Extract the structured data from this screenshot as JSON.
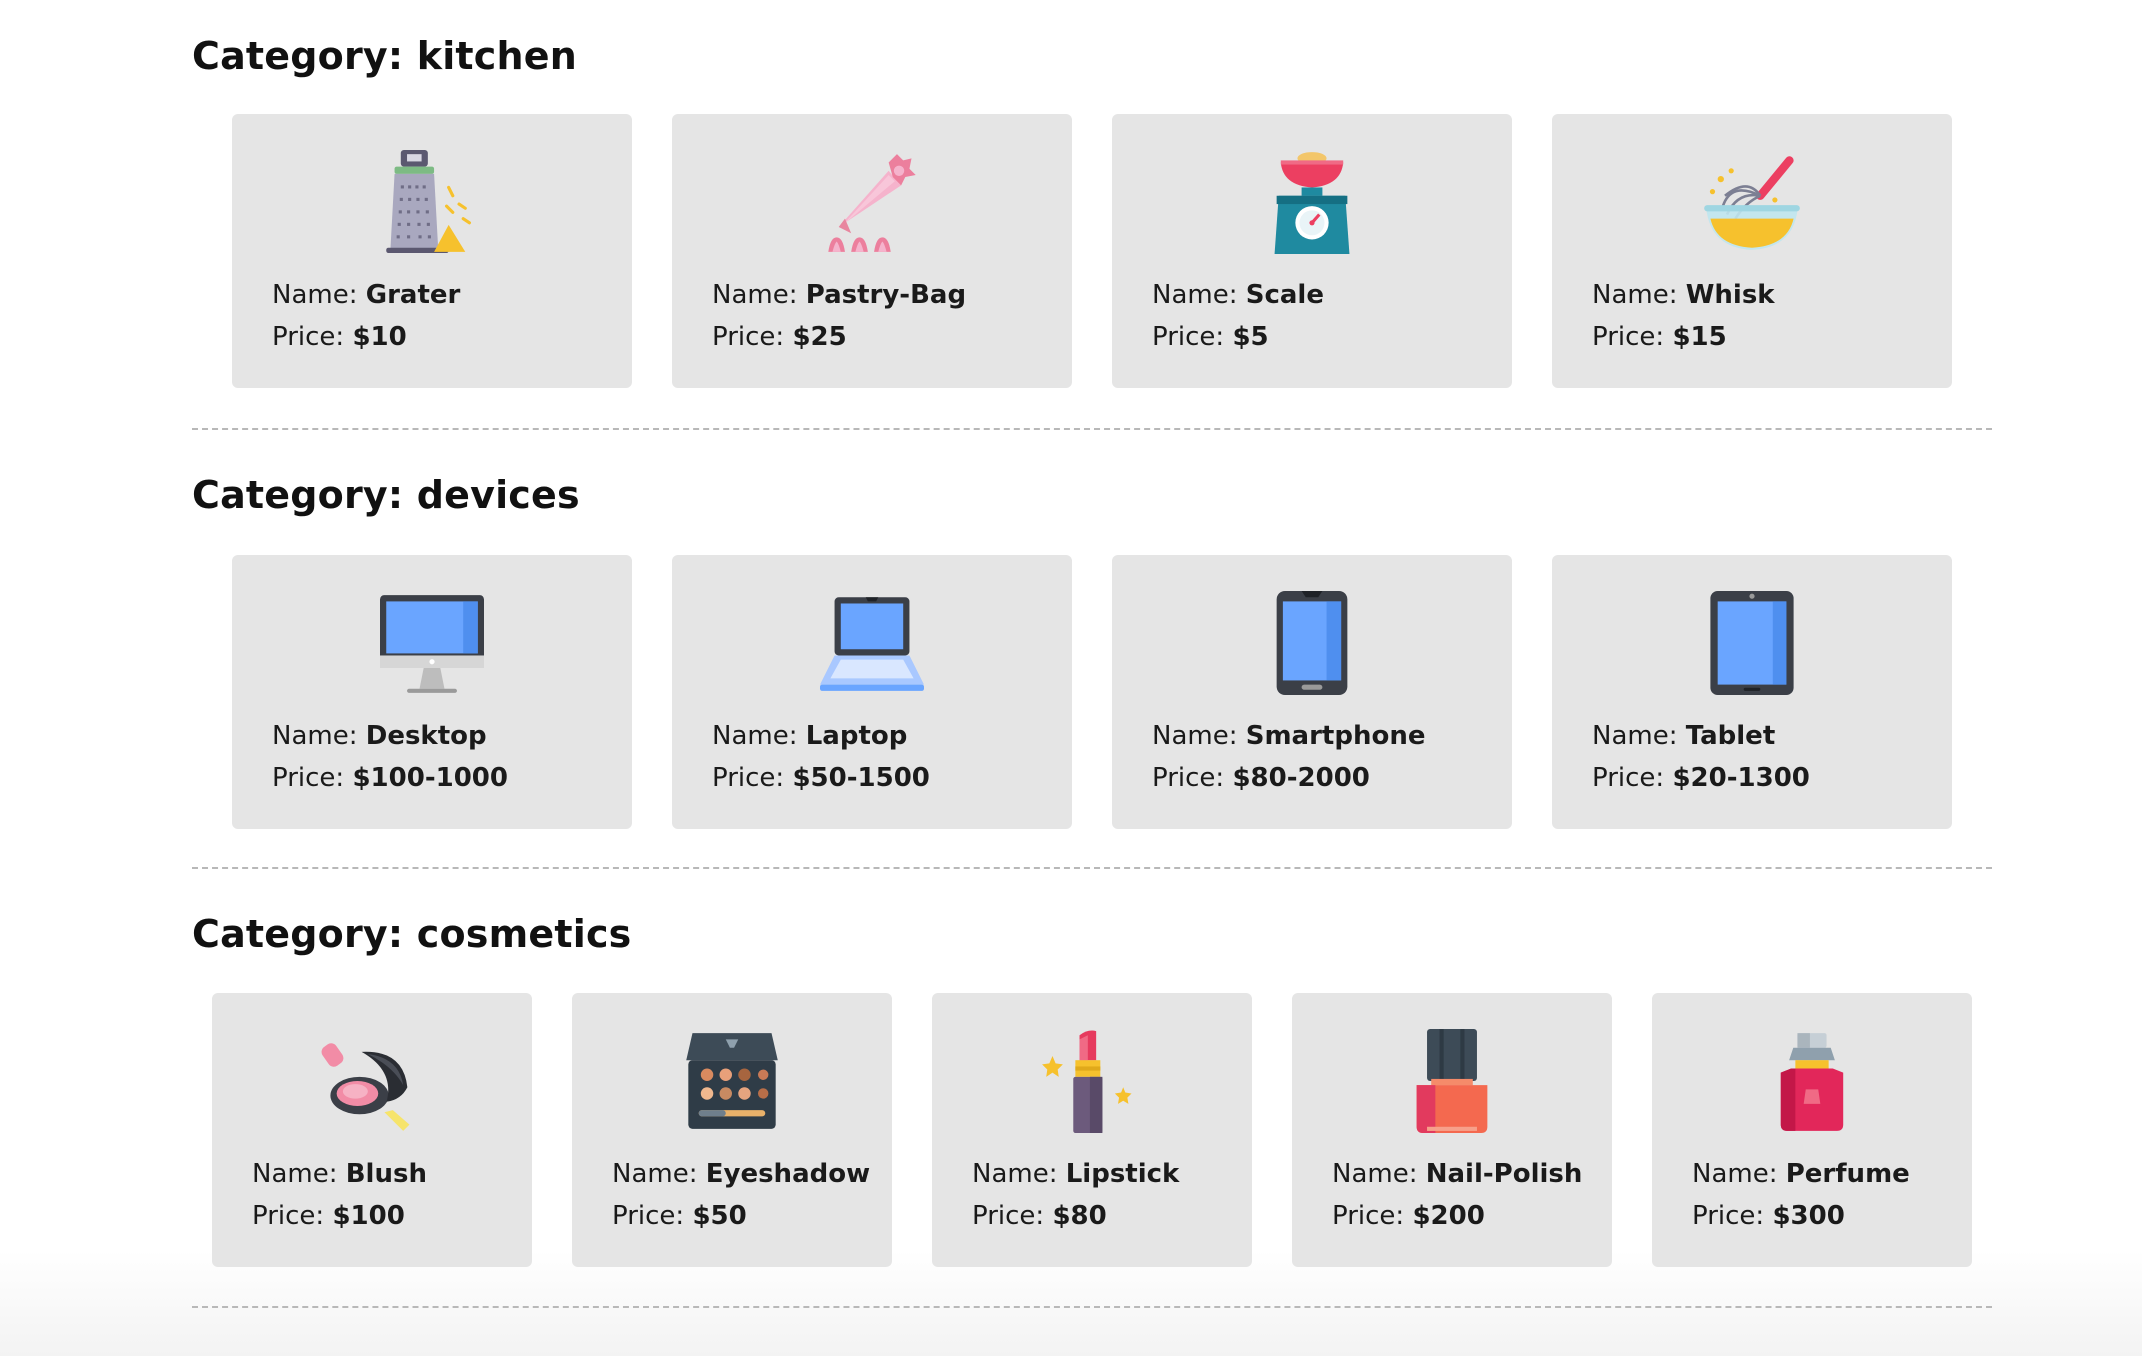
{
  "categories": [
    {
      "title_prefix": "Category:",
      "name": "kitchen",
      "items": [
        {
          "name_label": "Name:",
          "name": "Grater",
          "price_label": "Price:",
          "price": "$10",
          "icon": "grater-icon"
        },
        {
          "name_label": "Name:",
          "name": "Pastry-Bag",
          "price_label": "Price:",
          "price": "$25",
          "icon": "pastry-bag-icon"
        },
        {
          "name_label": "Name:",
          "name": "Scale",
          "price_label": "Price:",
          "price": "$5",
          "icon": "scale-icon"
        },
        {
          "name_label": "Name:",
          "name": "Whisk",
          "price_label": "Price:",
          "price": "$15",
          "icon": "whisk-icon"
        }
      ]
    },
    {
      "title_prefix": "Category:",
      "name": "devices",
      "items": [
        {
          "name_label": "Name:",
          "name": "Desktop",
          "price_label": "Price:",
          "price": "$100-1000",
          "icon": "desktop-icon"
        },
        {
          "name_label": "Name:",
          "name": "Laptop",
          "price_label": "Price:",
          "price": "$50-1500",
          "icon": "laptop-icon"
        },
        {
          "name_label": "Name:",
          "name": "Smartphone",
          "price_label": "Price:",
          "price": "$80-2000",
          "icon": "smartphone-icon"
        },
        {
          "name_label": "Name:",
          "name": "Tablet",
          "price_label": "Price:",
          "price": "$20-1300",
          "icon": "tablet-icon"
        }
      ]
    },
    {
      "title_prefix": "Category:",
      "name": "cosmetics",
      "items": [
        {
          "name_label": "Name:",
          "name": "Blush",
          "price_label": "Price:",
          "price": "$100",
          "icon": "blush-icon"
        },
        {
          "name_label": "Name:",
          "name": "Eyeshadow",
          "price_label": "Price:",
          "price": "$50",
          "icon": "eyeshadow-icon"
        },
        {
          "name_label": "Name:",
          "name": "Lipstick",
          "price_label": "Price:",
          "price": "$80",
          "icon": "lipstick-icon"
        },
        {
          "name_label": "Name:",
          "name": "Nail-Polish",
          "price_label": "Price:",
          "price": "$200",
          "icon": "nail-polish-icon"
        },
        {
          "name_label": "Name:",
          "name": "Perfume",
          "price_label": "Price:",
          "price": "$300",
          "icon": "perfume-icon"
        }
      ]
    }
  ],
  "colors": {
    "card_background": "#e5e5e5",
    "divider": "#b8b8b8",
    "device_screen": "#6aa5ff",
    "device_body": "#3b3f47"
  }
}
